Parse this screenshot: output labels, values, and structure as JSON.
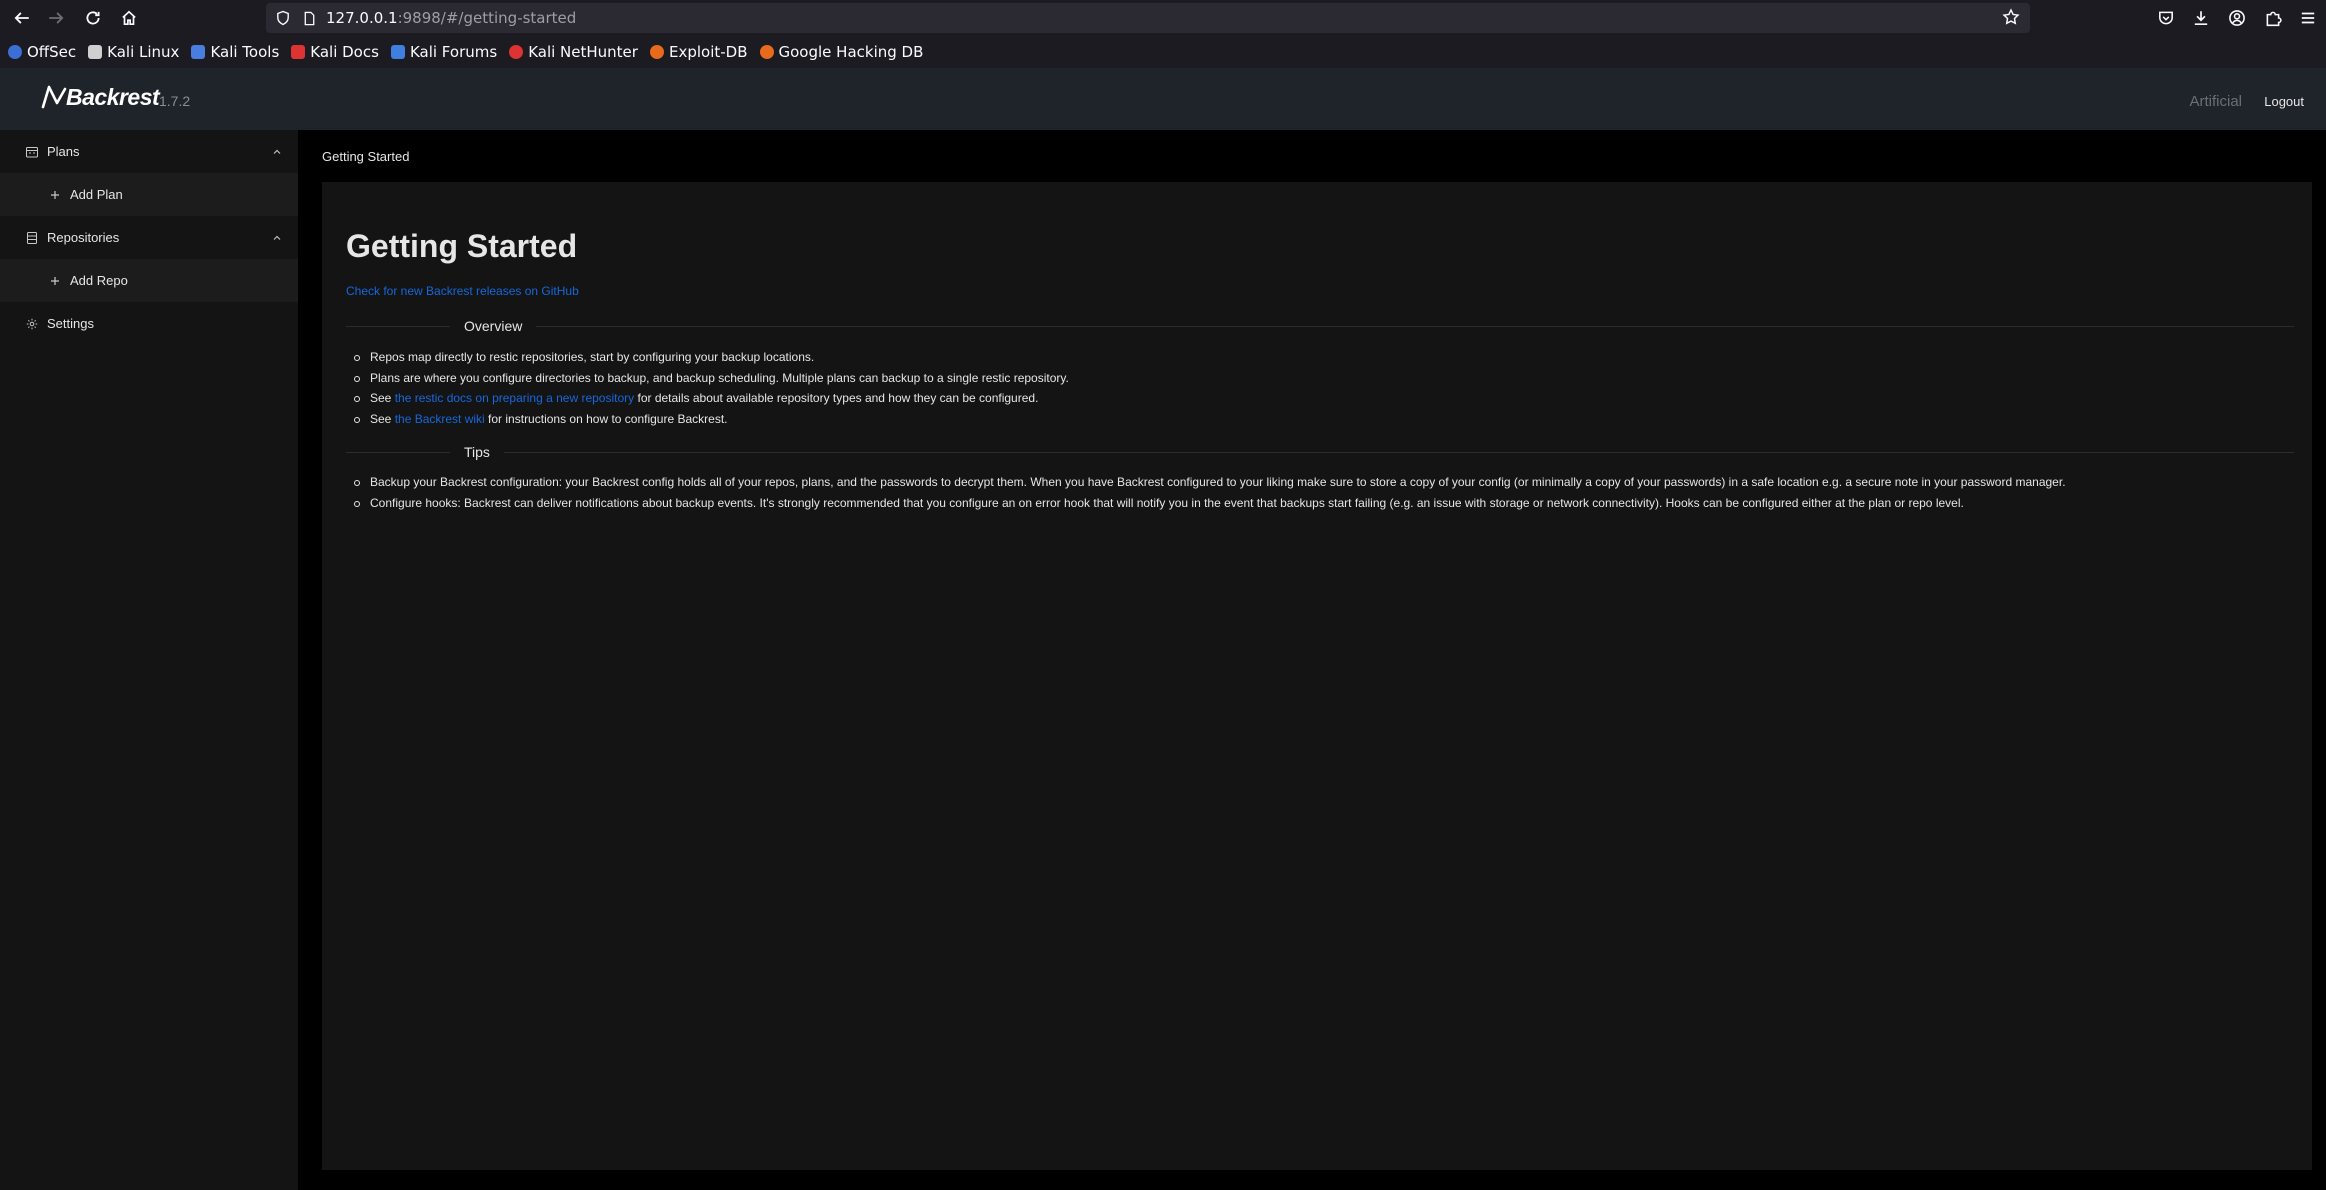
{
  "browser": {
    "url_host": "127.0.0.1",
    "url_rest": ":9898/#/getting-started",
    "bookmarks": [
      {
        "label": "OffSec",
        "color": "#3b6fd6"
      },
      {
        "label": "Kali Linux",
        "color": "#cfcfcf"
      },
      {
        "label": "Kali Tools",
        "color": "#4a7de0"
      },
      {
        "label": "Kali Docs",
        "color": "#d33"
      },
      {
        "label": "Kali Forums",
        "color": "#3f7fe0"
      },
      {
        "label": "Kali NetHunter",
        "color": "#d33"
      },
      {
        "label": "Exploit-DB",
        "color": "#e86a1c"
      },
      {
        "label": "Google Hacking DB",
        "color": "#e86a1c"
      }
    ]
  },
  "header": {
    "logo_text": "Backrest",
    "version": "1.7.2",
    "host": "Artificial",
    "logout_label": "Logout"
  },
  "sidebar": {
    "plans_label": "Plans",
    "add_plan_label": "Add Plan",
    "repos_label": "Repositories",
    "add_repo_label": "Add Repo",
    "settings_label": "Settings"
  },
  "main": {
    "breadcrumb": "Getting Started",
    "title": "Getting Started",
    "github_link": "Check for new Backrest releases on GitHub",
    "overview_heading": "Overview",
    "overview": {
      "item1": "Repos map directly to restic repositories, start by configuring your backup locations.",
      "item2": "Plans are where you configure directories to backup, and backup scheduling. Multiple plans can backup to a single restic repository.",
      "item3_prefix": "See ",
      "item3_link": "the restic docs on preparing a new repository",
      "item3_suffix": " for details about available repository types and how they can be configured.",
      "item4_prefix": "See ",
      "item4_link": "the Backrest wiki",
      "item4_suffix": " for instructions on how to configure Backrest."
    },
    "tips_heading": "Tips",
    "tips": {
      "item1": "Backup your Backrest configuration: your Backrest config holds all of your repos, plans, and the passwords to decrypt them. When you have Backrest configured to your liking make sure to store a copy of your config (or minimally a copy of your passwords) in a safe location e.g. a secure note in your password manager.",
      "item2": "Configure hooks: Backrest can deliver notifications about backup events. It's strongly recommended that you configure an on error hook that will notify you in the event that backups start failing (e.g. an issue with storage or network connectivity). Hooks can be configured either at the plan or repo level."
    }
  },
  "colors": {
    "link": "#1668dc",
    "header_bg": "#1f232a",
    "sidebar_bg": "#141414",
    "content_bg": "#141414"
  }
}
